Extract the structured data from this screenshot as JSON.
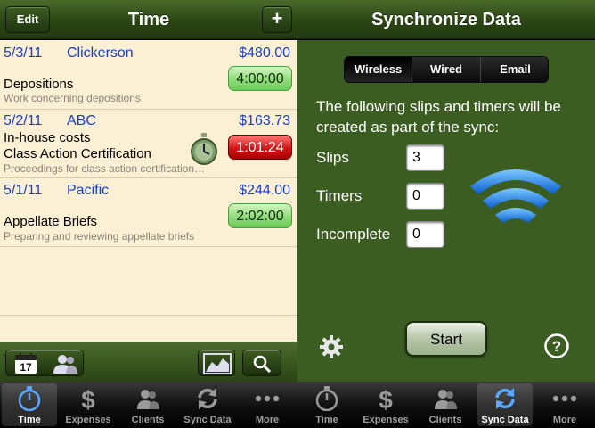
{
  "left": {
    "title": "Time",
    "edit_label": "Edit",
    "add_label": "+",
    "entries": [
      {
        "date": "5/3/11",
        "client": "Clickerson",
        "amount": "$480.00",
        "line1": "",
        "line2": "Depositions",
        "description": "Work concerning depositions",
        "timer": "4:00:00",
        "timer_state": "stopped"
      },
      {
        "date": "5/2/11",
        "client": "ABC",
        "amount": "$163.73",
        "line1": "In-house costs",
        "line2": "Class Action Certification",
        "description": "Proceedings for class action certification…",
        "timer": "1:01:24",
        "timer_state": "running"
      },
      {
        "date": "5/1/11",
        "client": "Pacific",
        "amount": "$244.00",
        "line1": "",
        "line2": "Appellate Briefs",
        "description": "Preparing and reviewing appellate briefs",
        "timer": "2:02:00",
        "timer_state": "stopped"
      }
    ],
    "toolbar_icons": [
      "calendar-icon",
      "clients-icon",
      "chart-icon",
      "search-icon"
    ],
    "calendar_day": "17"
  },
  "right": {
    "title": "Synchronize Data",
    "segments": [
      "Wireless",
      "Wired",
      "Email"
    ],
    "selected_segment": "Wireless",
    "description": "The following slips and timers will be created as part of the sync:",
    "counts": [
      {
        "label": "Slips",
        "value": "3"
      },
      {
        "label": "Timers",
        "value": "0"
      },
      {
        "label": "Incomplete",
        "value": "0"
      }
    ],
    "start_label": "Start",
    "help_label": "?"
  },
  "tabs_left": [
    {
      "label": "Time",
      "icon": "stopwatch-icon",
      "active": true
    },
    {
      "label": "Expenses",
      "icon": "dollar-icon",
      "active": false
    },
    {
      "label": "Clients",
      "icon": "clients-icon",
      "active": false
    },
    {
      "label": "Sync Data",
      "icon": "sync-icon",
      "active": false
    },
    {
      "label": "More",
      "icon": "more-icon",
      "active": false
    }
  ],
  "tabs_right": [
    {
      "label": "Time",
      "icon": "stopwatch-icon",
      "active": false
    },
    {
      "label": "Expenses",
      "icon": "dollar-icon",
      "active": false
    },
    {
      "label": "Clients",
      "icon": "clients-icon",
      "active": false
    },
    {
      "label": "Sync Data",
      "icon": "sync-icon",
      "active": true
    },
    {
      "label": "More",
      "icon": "more-icon",
      "active": false
    }
  ],
  "colors": {
    "nav_green": "#2b4514",
    "list_bg": "#fbf0d4",
    "link_blue": "#1a3ec8",
    "timer_green": "#8fdc7a",
    "timer_red": "#d41414",
    "sync_bg": "#3b5d22",
    "wifi_blue": "#1e88e5"
  }
}
